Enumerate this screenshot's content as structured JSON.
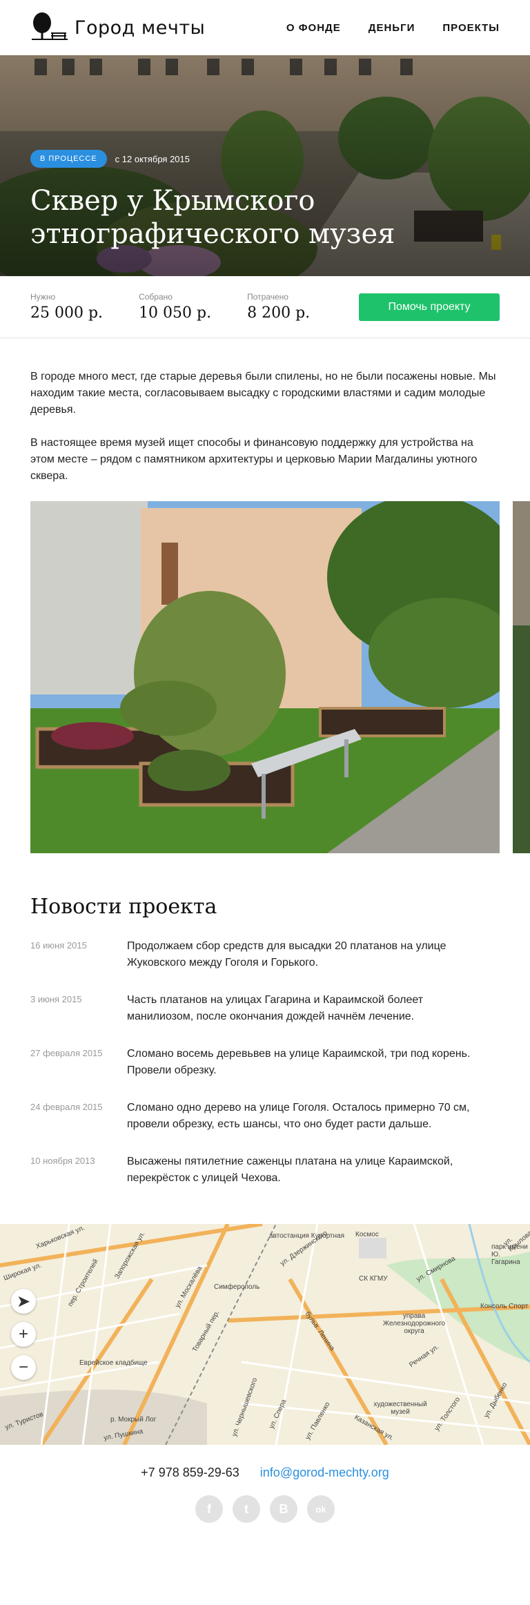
{
  "header": {
    "logo_text": "Город мечты",
    "nav": [
      "О ФОНДЕ",
      "ДЕНЬГИ",
      "ПРОЕКТЫ"
    ]
  },
  "hero": {
    "status": "В ПРОЦЕССЕ",
    "date": "с 12 октября 2015",
    "title": "Сквер у Крымского этнографического музея"
  },
  "stats": {
    "needed_label": "Нужно",
    "needed_value": "25 000 р.",
    "collected_label": "Собрано",
    "collected_value": "10 050 р.",
    "spent_label": "Потрачено",
    "spent_value": "8 200 р.",
    "help_button": "Помочь проекту"
  },
  "description": [
    "В городе много мест, где старые деревья были спилены, но не были посажены новые. Мы находим такие места, согласовываем высадку с городскими властями и садим молодые деревья.",
    "В настоящее время музей ищет способы и финансовую поддержку для устройства на этом месте – рядом с памятником архитектуры и церковью Марии Магдалины уютного сквера."
  ],
  "news": {
    "title": "Новости проекта",
    "items": [
      {
        "date": "16 июня 2015",
        "text": "Продолжаем сбор средств для высадки 20 платанов на улице Жуковского между Гоголя и Горького."
      },
      {
        "date": "3 июня 2015",
        "text": "Часть платанов на улицах Гагарина и Караимской болеет манилиозом, после окончания дождей начнём лечение."
      },
      {
        "date": "27 февраля 2015",
        "text": "Сломано восемь деревьвев на улице Караимской, три под корень. Провели обрезку."
      },
      {
        "date": "24 февраля 2015",
        "text": "Сломано одно дерево на улице Гоголя. Осталось примерно 70 см, провели обрезку, есть шансы, что оно будет расти дальше."
      },
      {
        "date": "10 ноября 2013",
        "text": "Высажены пятилетние саженцы платана на улице Караимской, перекрёсток с улицей Чехова."
      }
    ]
  },
  "map": {
    "labels": [
      "Харьковская ул.",
      "Запорожская ул.",
      "автостанция Курортная",
      "Симферополь",
      "СК КГМУ",
      "Космос",
      "Еврейское кладбище",
      "ул. Москалёва",
      "Товарный пер.",
      "бульв. Ленина",
      "управа Железнодорожного округа",
      "художественный музей",
      "ул. Павленко",
      "ул. Толстого",
      "Речная ул.",
      "Консоль Спорт",
      "ул. Чернышевского",
      "ул. Дыбенко",
      "р. Мокрый Лог",
      "ул. Туристов",
      "Широкая ул.",
      "пер. Строителей",
      "ул. Крылова",
      "ул. Спера",
      "ул. Дзержинского",
      "ул. Смирнова",
      "Казанская ул.",
      "парк имени Ю. Гагарина",
      "ул. Пушкина"
    ]
  },
  "footer": {
    "phone": "+7 978 859-29-63",
    "email": "info@gorod-mechty.org",
    "socials": [
      "f",
      "t",
      "В",
      "ok"
    ]
  },
  "colors": {
    "accent_blue": "#2b8fe0",
    "accent_green": "#1ec26a"
  }
}
